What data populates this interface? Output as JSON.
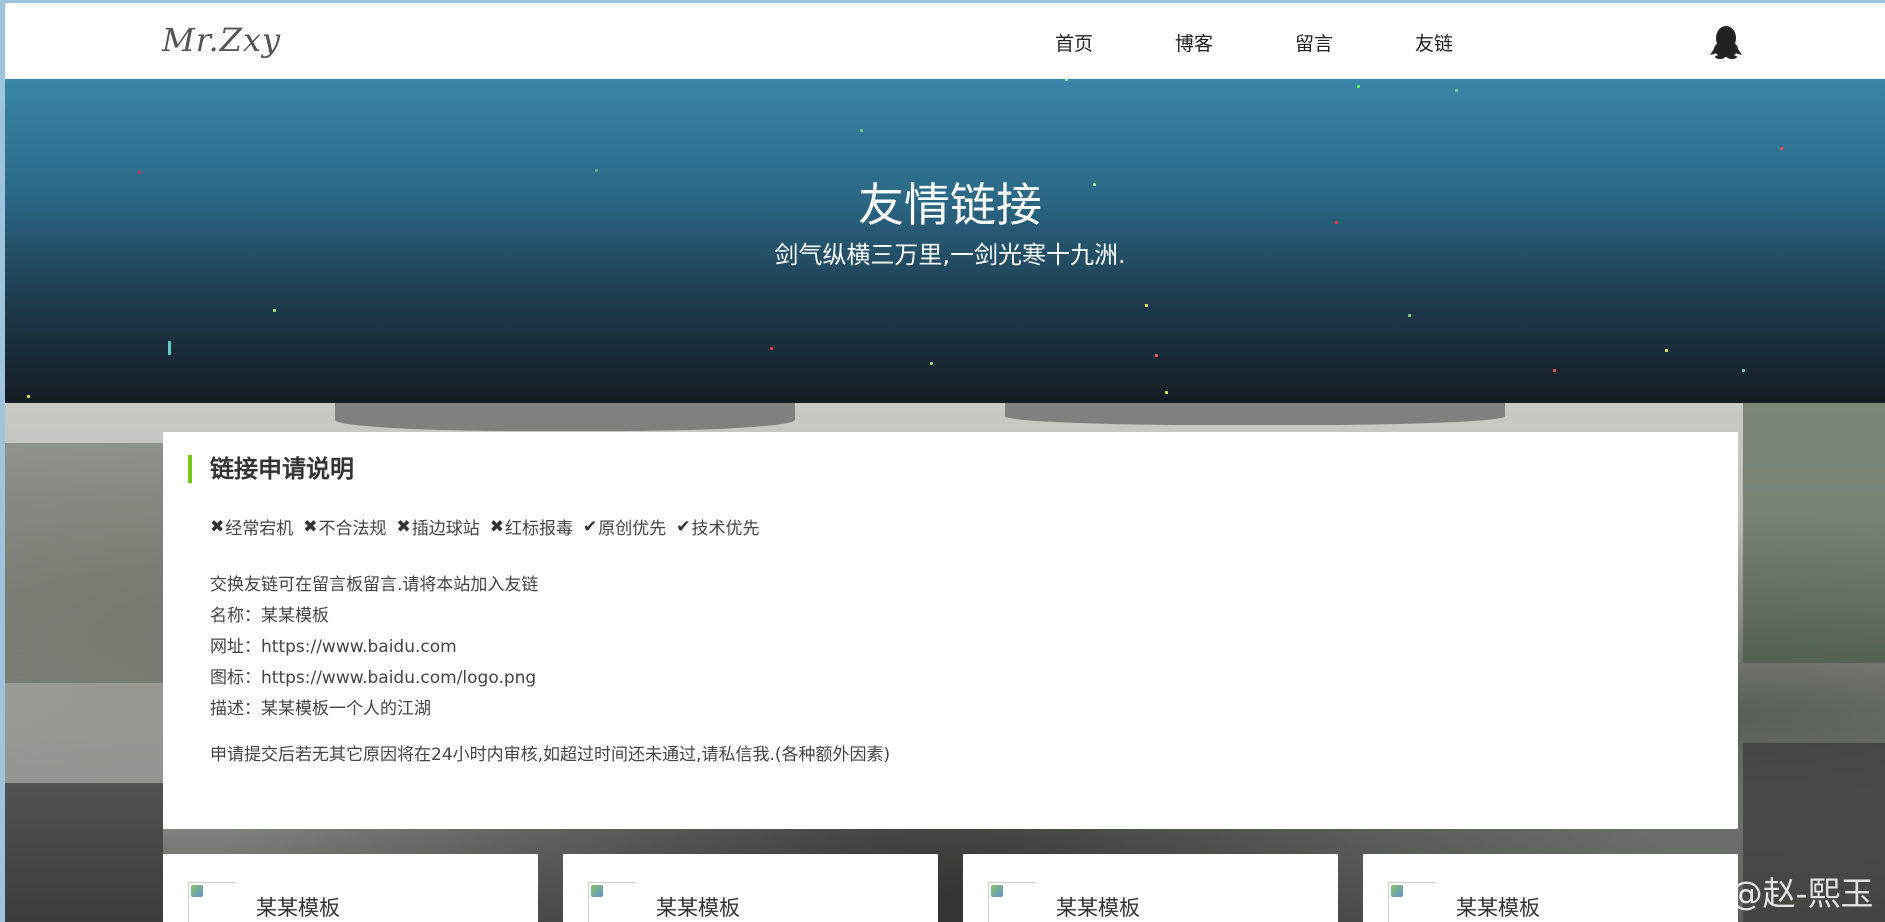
{
  "header": {
    "logo": "Mr.Zxy",
    "nav": [
      "首页",
      "博客",
      "留言",
      "友链"
    ],
    "qq_icon": "qq-penguin-icon"
  },
  "hero": {
    "title": "友情链接",
    "subtitle": "剑气纵横三万里,一剑光寒十九洲."
  },
  "card": {
    "title": "链接申请说明",
    "accent_color": "#7cc31f",
    "rules": [
      {
        "mark": "✖",
        "text": "经常宕机"
      },
      {
        "mark": "✖",
        "text": "不合法规"
      },
      {
        "mark": "✖",
        "text": "插边球站"
      },
      {
        "mark": "✖",
        "text": "红标报毒"
      },
      {
        "mark": "✔",
        "text": "原创优先"
      },
      {
        "mark": "✔",
        "text": "技术优先"
      }
    ],
    "info": [
      "交换友链可在留言板留言.请将本站加入友链",
      "名称：某某模板",
      "网址：https://www.baidu.com",
      "图标：https://www.baidu.com/logo.png",
      "描述：某某模板一个人的江湖"
    ],
    "note": "申请提交后若无其它原因将在24小时内审核,如超过时间还未通过,请私信我.(各种额外因素)"
  },
  "friends": [
    {
      "name": "某某模板"
    },
    {
      "name": "某某模板"
    },
    {
      "name": "某某模板"
    },
    {
      "name": "某某模板"
    }
  ],
  "watermark": "CSDN @赵-熙玉"
}
